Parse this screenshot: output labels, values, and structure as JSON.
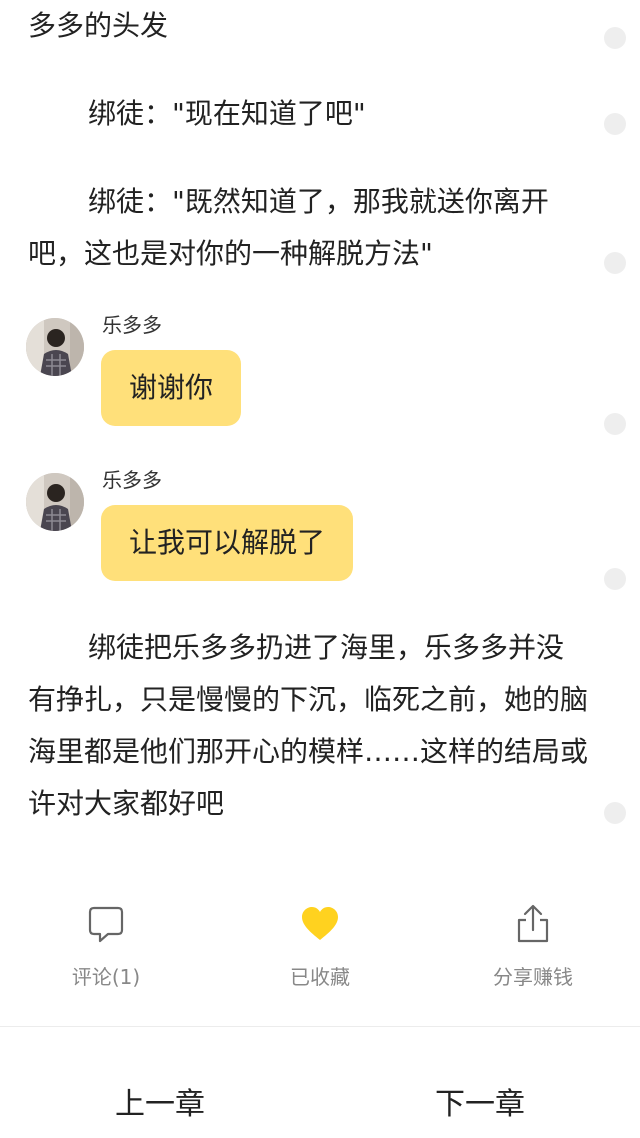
{
  "story": {
    "paragraphs": [
      "多多的头发",
      "绑徒：\"现在知道了吧\"",
      "绑徒：\"既然知道了，那我就送你离开吧，这也是对你的一种解脱方法\"",
      "绑徒把乐多多扔进了海里，乐多多并没有挣扎，只是慢慢的下沉，临死之前，她的脑海里都是他们那开心的模样……这样的结局或许对大家都好吧"
    ],
    "messages": [
      {
        "sender": "乐多多",
        "text": "谢谢你"
      },
      {
        "sender": "乐多多",
        "text": "让我可以解脱了"
      }
    ]
  },
  "actions": {
    "comment": {
      "label": "评论(1)",
      "icon": "comment-icon"
    },
    "favorite": {
      "label": "已收藏",
      "icon": "heart-icon",
      "active": true
    },
    "share": {
      "label": "分享赚钱",
      "icon": "share-icon"
    }
  },
  "navigation": {
    "prev_label": "上一章",
    "next_label": "下一章"
  },
  "colors": {
    "bubble": "#ffe07a",
    "heart": "#ffd21f",
    "icon_stroke": "#666666",
    "label": "#888888",
    "side_dot": "#eeeeee"
  }
}
